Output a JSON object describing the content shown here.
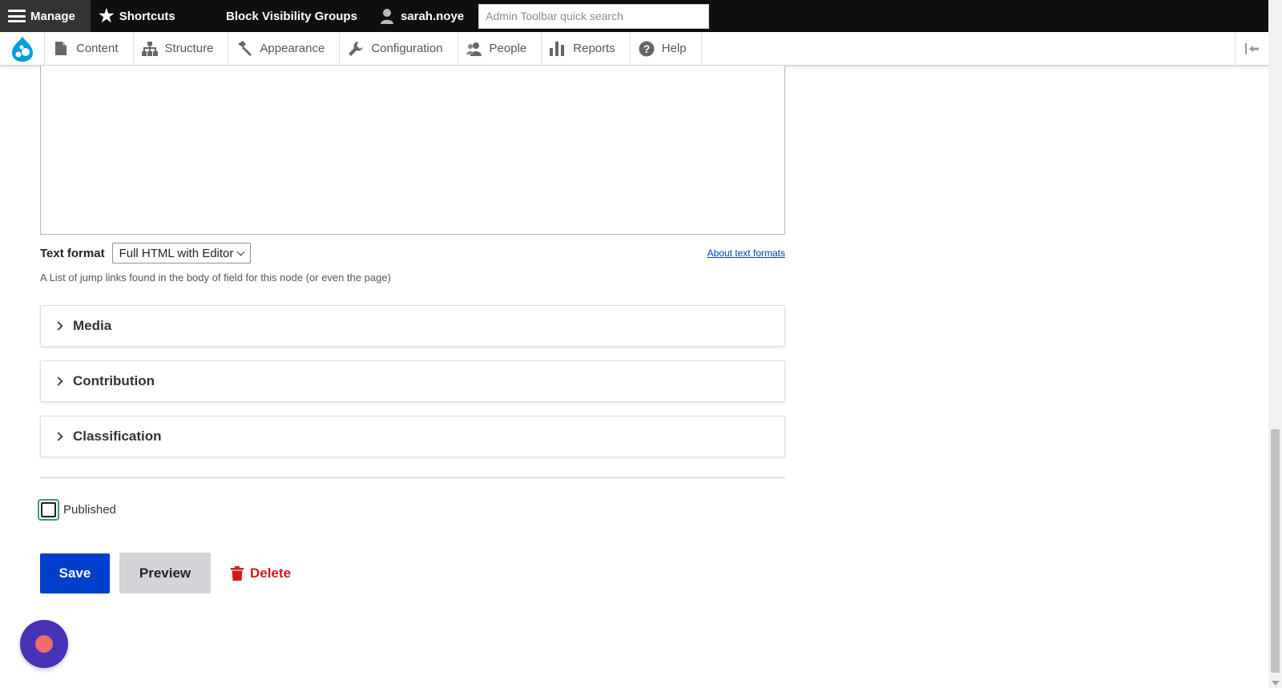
{
  "toolbar": {
    "manage_label": "Manage",
    "shortcuts_label": "Shortcuts",
    "site_label": "Block Visibility Groups",
    "user_label": "sarah.noye",
    "search_placeholder": "Admin Toolbar quick search"
  },
  "tray": {
    "items": [
      {
        "label": "Content",
        "icon": "page-icon"
      },
      {
        "label": "Structure",
        "icon": "hierarchy-icon"
      },
      {
        "label": "Appearance",
        "icon": "paint-hammer-icon"
      },
      {
        "label": "Configuration",
        "icon": "wrench-icon"
      },
      {
        "label": "People",
        "icon": "people-icon"
      },
      {
        "label": "Reports",
        "icon": "bar-chart-icon"
      },
      {
        "label": "Help",
        "icon": "help-icon"
      }
    ]
  },
  "form": {
    "text_format_label": "Text format",
    "text_format_value": "Full HTML with Editor",
    "about_link": "About text formats",
    "help_text": "A List of jump links found in the body of field for this node (or even the page)",
    "sections": {
      "media": "Media",
      "contribution": "Contribution",
      "classification": "Classification"
    },
    "published_label": "Published",
    "published_checked": false
  },
  "actions": {
    "save_label": "Save",
    "preview_label": "Preview",
    "delete_label": "Delete"
  },
  "colors": {
    "primary": "#003ecc",
    "danger": "#d21b1b",
    "drupal_blue": "#009cde",
    "record_button": "#4532b5"
  }
}
